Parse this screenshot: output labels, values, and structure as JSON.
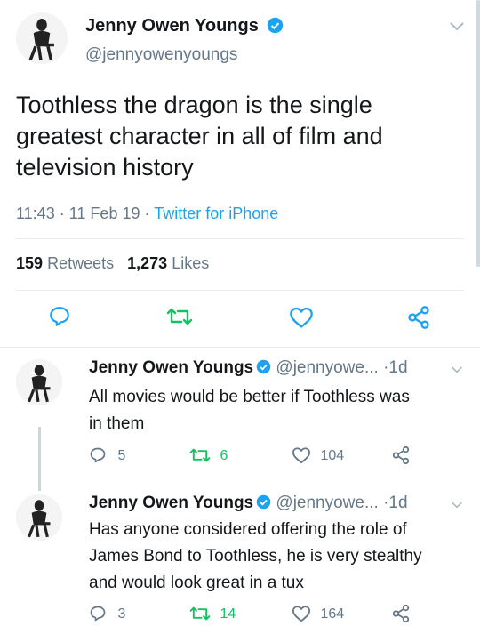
{
  "main_tweet": {
    "author_name": "Jenny Owen Youngs",
    "handle": "@jennyowenyoungs",
    "text_lines": [
      "Toothless the dragon is the single",
      "greatest character in all of film and",
      "television history"
    ],
    "time": "11:43",
    "date": "11 Feb 19",
    "source": "Twitter for iPhone",
    "retweets_count": "159",
    "retweets_label": "Retweets",
    "likes_count": "1,273",
    "likes_label": "Likes"
  },
  "replies": [
    {
      "author_name": "Jenny Owen Youngs",
      "handle": "@jennyowe...",
      "age": "1d",
      "text_lines": [
        "All movies would be better if Toothless was",
        "in them"
      ],
      "reply_count": "5",
      "retweet_count": "6",
      "like_count": "104"
    },
    {
      "author_name": "Jenny Owen Youngs",
      "handle": "@jennyowe...",
      "age": "1d",
      "text_lines": [
        "Has anyone considered offering the role of",
        "James Bond to Toothless, he is very stealthy",
        "and would look great in a tux"
      ],
      "reply_count": "3",
      "retweet_count": "14",
      "like_count": "164"
    }
  ],
  "icons": {
    "reply": "reply-icon",
    "retweet": "retweet-icon",
    "like": "heart-icon",
    "share": "share-icon",
    "verified": "verified-badge-icon",
    "caret": "chevron-down-icon"
  },
  "colors": {
    "accent": "#1da1f2",
    "retweet": "#17bf63",
    "muted": "#657786",
    "text": "#14171a"
  }
}
